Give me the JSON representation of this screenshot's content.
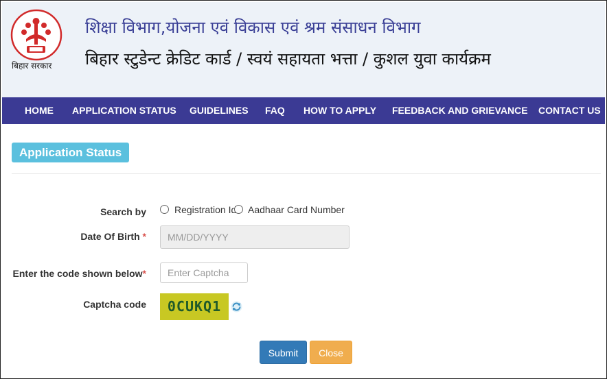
{
  "header": {
    "line1": "शिक्षा विभाग,योजना एवं विकास एवं श्रम संसाधन विभाग",
    "line2": "बिहार स्टुडेन्ट क्रेडिट कार्ड / स्वयं सहायता भत्ता / कुशल युवा कार्यक्रम",
    "logo_caption": "बिहार सरकार"
  },
  "nav": {
    "items": [
      "HOME",
      "APPLICATION STATUS",
      "GUIDELINES",
      "FAQ",
      "HOW TO APPLY",
      "FEEDBACK AND GRIEVANCE",
      "CONTACT US"
    ]
  },
  "section": {
    "title": "Application Status"
  },
  "form": {
    "search_by_label": "Search by",
    "option_registration": "Registration Id",
    "option_aadhaar": "Aadhaar Card Number",
    "dob_label": "Date Of Birth",
    "dob_placeholder": "MM/DD/YYYY",
    "captcha_entry_label": "Enter the code shown below",
    "captcha_placeholder": "Enter Captcha",
    "captcha_code_label": "Captcha code",
    "captcha_value": "0CUKQ1",
    "required_mark": "*"
  },
  "buttons": {
    "submit": "Submit",
    "close": "Close"
  },
  "colors": {
    "nav_bg": "#3b3a94",
    "badge_bg": "#5bc0de",
    "submit_bg": "#337ab7",
    "close_bg": "#f0ad4e",
    "captcha_bg": "#c8c823"
  }
}
